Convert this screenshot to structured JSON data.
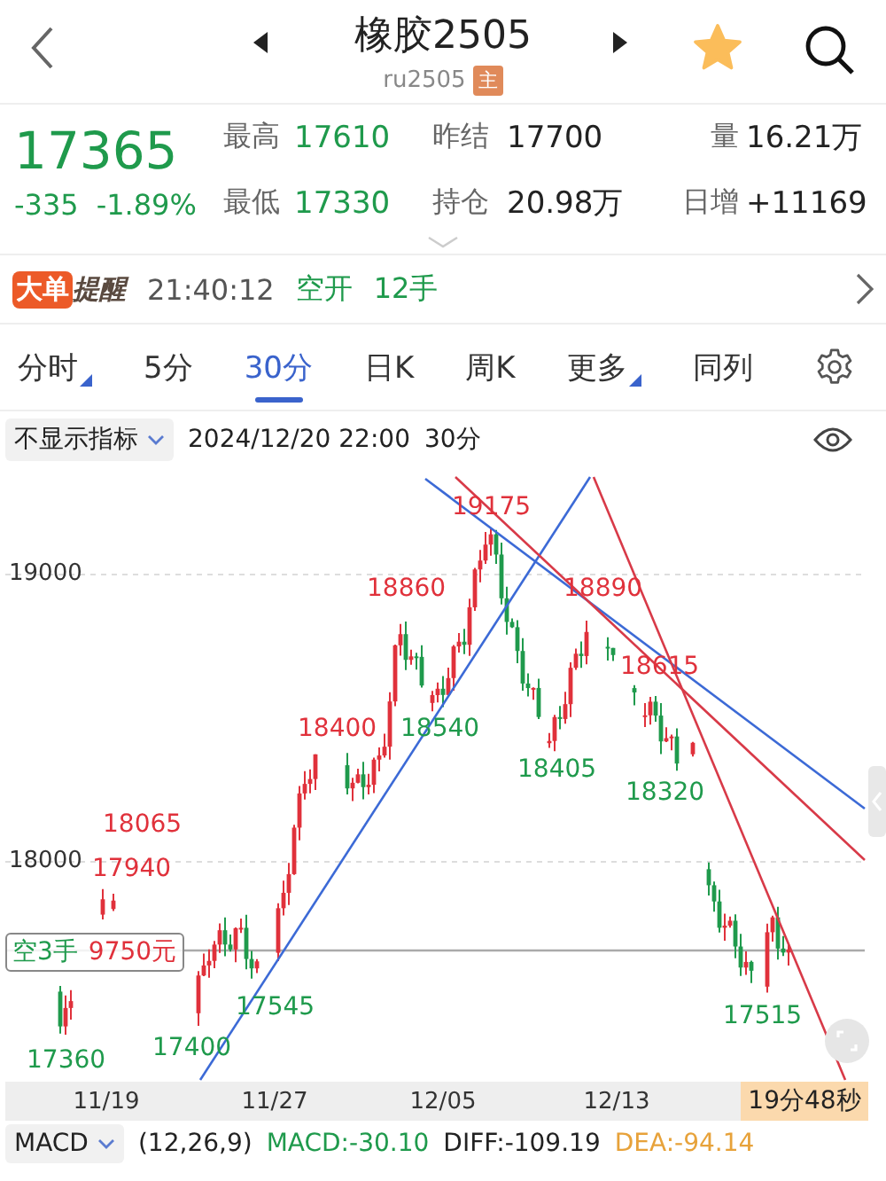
{
  "header": {
    "title": "橡胶2505",
    "code": "ru2505",
    "badge": "主",
    "favorite": true
  },
  "quote": {
    "price": "17365",
    "change": "-335",
    "change_pct": "-1.89%",
    "stats": [
      {
        "label": "最高",
        "value": "17610",
        "color": "#1f9a4c"
      },
      {
        "label": "昨结",
        "value": "17700",
        "color": "#222222"
      },
      {
        "label": "量",
        "value": "16.21万",
        "color": "#222222"
      },
      {
        "label": "最低",
        "value": "17330",
        "color": "#1f9a4c"
      },
      {
        "label": "持仓",
        "value": "20.98万",
        "color": "#222222"
      },
      {
        "label": "日增",
        "value": "+11169",
        "color": "#222222"
      }
    ]
  },
  "alert": {
    "tag": "大单",
    "title": "提醒",
    "time": "21:40:12",
    "action": "空开",
    "volume": "12手"
  },
  "periods": [
    {
      "label": "分时",
      "selected": false,
      "has_menu": true
    },
    {
      "label": "5分",
      "selected": false,
      "has_menu": false
    },
    {
      "label": "30分",
      "selected": true,
      "has_menu": false
    },
    {
      "label": "日K",
      "selected": false,
      "has_menu": false
    },
    {
      "label": "周K",
      "selected": false,
      "has_menu": false
    },
    {
      "label": "更多",
      "selected": false,
      "has_menu": true
    },
    {
      "label": "同列",
      "selected": false,
      "has_menu": false
    }
  ],
  "indicator": {
    "selector": "不显示指标",
    "datetime": "2024/12/20 22:00",
    "period": "30分"
  },
  "chart": {
    "y_labels": [
      "19000",
      "18000"
    ],
    "x_labels": [
      "11/19",
      "11/27",
      "12/05",
      "12/13"
    ],
    "price_marks": [
      {
        "text": "19175",
        "kind": "high"
      },
      {
        "text": "18860",
        "kind": "high"
      },
      {
        "text": "18890",
        "kind": "high"
      },
      {
        "text": "18615",
        "kind": "high"
      },
      {
        "text": "18400",
        "kind": "high"
      },
      {
        "text": "18540",
        "kind": "low"
      },
      {
        "text": "18405",
        "kind": "low"
      },
      {
        "text": "18320",
        "kind": "low"
      },
      {
        "text": "18065",
        "kind": "high"
      },
      {
        "text": "17940",
        "kind": "high"
      },
      {
        "text": "17360",
        "kind": "low"
      },
      {
        "text": "17400",
        "kind": "low"
      },
      {
        "text": "17545",
        "kind": "low"
      },
      {
        "text": "17515",
        "kind": "low"
      }
    ],
    "position": {
      "side": "空3手",
      "pnl": "9750元"
    },
    "countdown": "19分48秒"
  },
  "macd": {
    "selector": "MACD",
    "params": "(12,26,9)",
    "macd": "MACD:-30.10",
    "diff": "DIFF:-109.19",
    "dea": "DEA:-94.14"
  }
}
